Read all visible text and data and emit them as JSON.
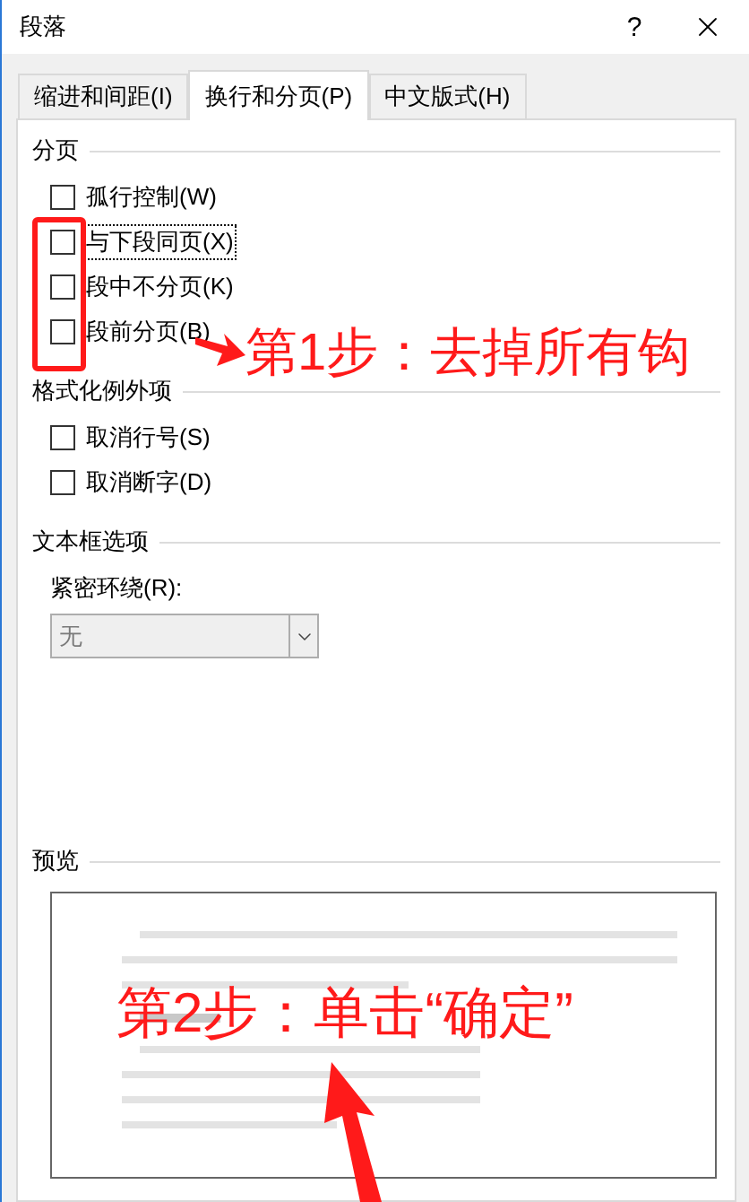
{
  "window": {
    "title": "段落",
    "help": "?"
  },
  "tabs": [
    {
      "label": "缩进和间距(I)",
      "selected": false
    },
    {
      "label": "换行和分页(P)",
      "selected": true
    },
    {
      "label": "中文版式(H)",
      "selected": false
    }
  ],
  "sections": [
    {
      "title": "分页",
      "kind": "checkboxes",
      "items": [
        {
          "label": "孤行控制(W)",
          "checked": false,
          "focused": false
        },
        {
          "label": "与下段同页(X)",
          "checked": false,
          "focused": true
        },
        {
          "label": "段中不分页(K)",
          "checked": false,
          "focused": false
        },
        {
          "label": "段前分页(B)",
          "checked": false,
          "focused": false
        }
      ]
    },
    {
      "title": "格式化例外项",
      "kind": "checkboxes",
      "items": [
        {
          "label": "取消行号(S)",
          "checked": false,
          "focused": false
        },
        {
          "label": "取消断字(D)",
          "checked": false,
          "focused": false
        }
      ]
    },
    {
      "title": "文本框选项",
      "kind": "dropdown",
      "label": "紧密环绕(R):",
      "value": "无",
      "disabled": true
    },
    {
      "title": "预览",
      "kind": "preview"
    }
  ],
  "annotations": [
    {
      "text": "第1步：去掉所有钩"
    },
    {
      "text": "第2步：单击“确定”"
    }
  ]
}
